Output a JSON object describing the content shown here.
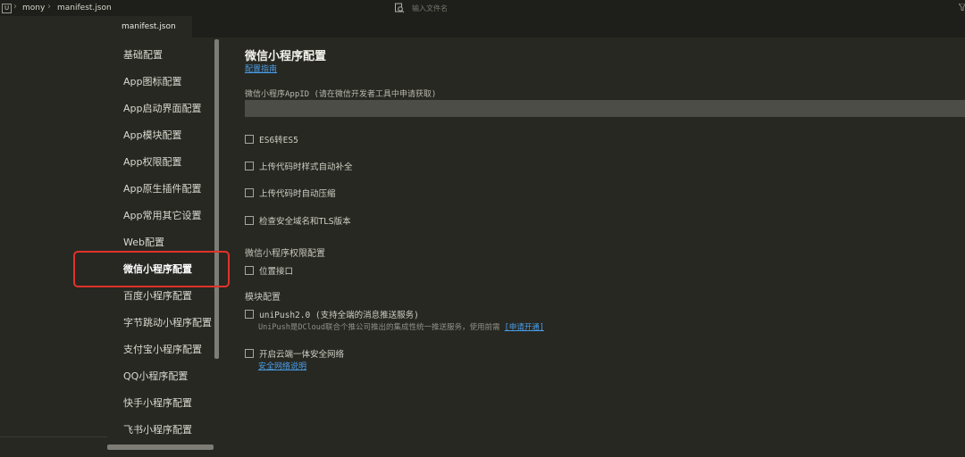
{
  "topbar": {
    "project_icon": "U",
    "breadcrumb": [
      "mony",
      "manifest.json"
    ],
    "search_placeholder": "输入文件名"
  },
  "tab": {
    "label": "manifest.json"
  },
  "nav": {
    "items": [
      "基础配置",
      "App图标配置",
      "App启动界面配置",
      "App模块配置",
      "App权限配置",
      "App原生插件配置",
      "App常用其它设置",
      "Web配置",
      "微信小程序配置",
      "百度小程序配置",
      "字节跳动小程序配置",
      "支付宝小程序配置",
      "QQ小程序配置",
      "快手小程序配置",
      "飞书小程序配置"
    ],
    "active_index": 8
  },
  "content": {
    "title": "微信小程序配置",
    "guide_link": "配置指南",
    "appid_label": "微信小程序AppID (请在微信开发者工具中申请获取)",
    "appid_value": "",
    "options": [
      {
        "label": "ES6转ES5",
        "checked": false
      },
      {
        "label": "上传代码时样式自动补全",
        "checked": false
      },
      {
        "label": "上传代码时自动压缩",
        "checked": false
      },
      {
        "label": "检查安全域名和TLS版本",
        "checked": false
      }
    ],
    "permission_section": "微信小程序权限配置",
    "permission_option": {
      "label": "位置接口",
      "checked": false
    },
    "module_section": "模块配置",
    "unipush": {
      "label": "uniPush2.0 (支持全端的消息推送服务)",
      "checked": false,
      "description": "UniPush是DCloud联合个推公司推出的集成性统一推送服务，使用前需",
      "link": "[申请开通]"
    },
    "cloud_security": {
      "label": "开启云端一体安全网络",
      "checked": false,
      "link": "安全网络说明"
    }
  },
  "colors": {
    "background": "#272822",
    "topbar": "#1e1f1a",
    "link": "#4a9eea",
    "highlight_border": "#e0322b"
  }
}
